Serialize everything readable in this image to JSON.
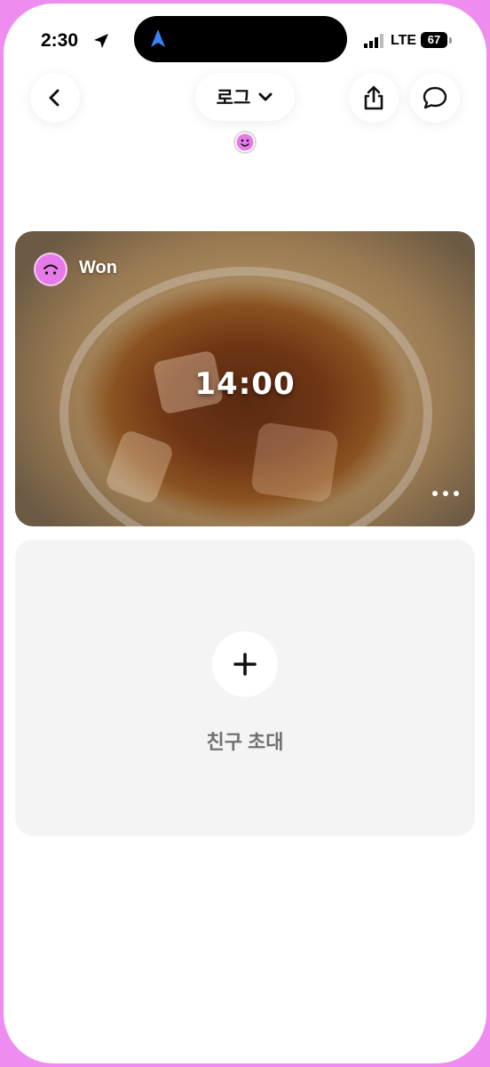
{
  "status_bar": {
    "time": "2:30",
    "network": "LTE",
    "battery": "67"
  },
  "header": {
    "title": "로그",
    "icons": {
      "back": "chevron-left-icon",
      "dropdown": "chevron-down-icon",
      "share": "share-icon",
      "chat": "chat-bubble-icon",
      "reaction": "smiley-icon"
    }
  },
  "post": {
    "user_name": "Won",
    "time_overlay": "14:00",
    "more_icon": "more-dots-icon"
  },
  "invite": {
    "label": "친구 초대",
    "icon": "plus-icon"
  },
  "colors": {
    "frame": "#ee8cf0",
    "avatar": "#e67ae8",
    "invite_bg": "#f4f4f4"
  }
}
